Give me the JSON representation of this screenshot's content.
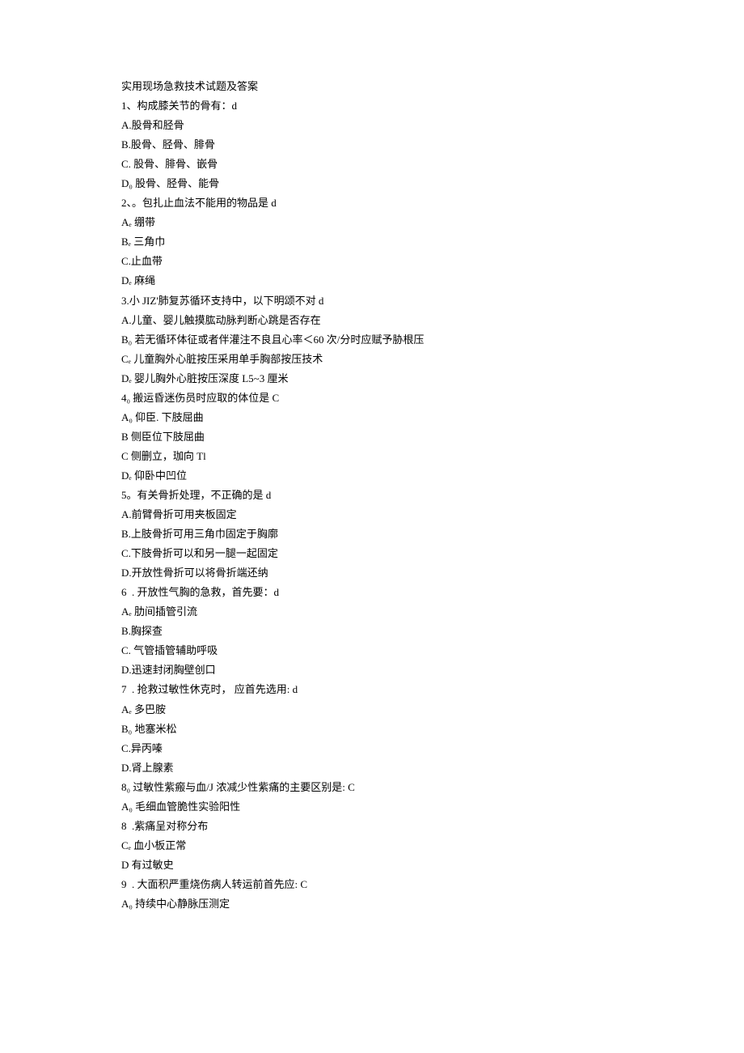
{
  "title": "实用现场急救技术试题及答案",
  "questions": [
    {
      "stem": "1、构成膝关节的骨有：d",
      "options": [
        "A.股骨和胫骨",
        "B.股骨、胫骨、腓骨",
        "C. 股骨、腓骨、嵌骨",
        "D₀ 股骨、胫骨、能骨"
      ]
    },
    {
      "stem": "2、。包扎止血法不能用的物品是 d",
      "options": [
        "Aₑ 绷带",
        "Bₑ 三角巾",
        "C.止血带",
        "Dₑ 麻绳"
      ]
    },
    {
      "stem": "3.小 JIZ'肺复苏循环支持中，以下明颂不对 d",
      "options": [
        "A.儿童、婴儿触摸肱动脉判断心跳是否存在",
        "B₀ 若无循环体征或者伴灌注不良且心率＜60 次/分时应赋予胁根压",
        "Cₑ 儿童胸外心脏按压采用单手胸部按压技术",
        "Dₑ 婴儿胸外心脏按压深度 L5~3 厘米"
      ]
    },
    {
      "stem": "4₀ 搬运昏迷伤员时应取的体位是 C",
      "options": [
        "A₀ 仰臣. 下肢屈曲",
        "B 侧臣位下肢屈曲",
        "C 侧删立，珈向 Tl",
        "Dₑ 仰卧中凹位"
      ]
    },
    {
      "stem": "5。有关骨折处理，不正确的是 d",
      "options": [
        "A.前臂骨折可用夹板固定",
        "B.上肢骨折可用三角巾固定于胸廓",
        "C.下肢骨折可以和另一腿一起固定",
        "D.开放性骨折可以将骨折端还纳"
      ]
    },
    {
      "stem": "6  . 开放性气胸的急救，首先要：d",
      "options": [
        "Aₑ 肋间插管引流",
        "B.胸探查",
        "C. 气管插管辅助呼吸",
        "D.迅速封闭胸壁创口"
      ]
    },
    {
      "stem": "7  . 抢救过敏性休克时， 应首先选用: d",
      "options": [
        "Aₑ 多巴胺",
        "B₀ 地塞米松",
        "C.异丙嗪",
        "D.肾上腺素"
      ]
    },
    {
      "stem": "8₀ 过敏性紫瘢与血/J 浓减少性紫痛的主要区别是: C",
      "options": [
        "A₀ 毛细血管脆性实验阳性",
        "8  .紫痛呈对称分布",
        "Cₑ 血小板正常",
        "D 有过敏史"
      ]
    },
    {
      "stem": "9  . 大面积严重烧伤病人转运前首先应: C",
      "options": [
        "A₀ 持续中心静脉压测定"
      ]
    }
  ]
}
